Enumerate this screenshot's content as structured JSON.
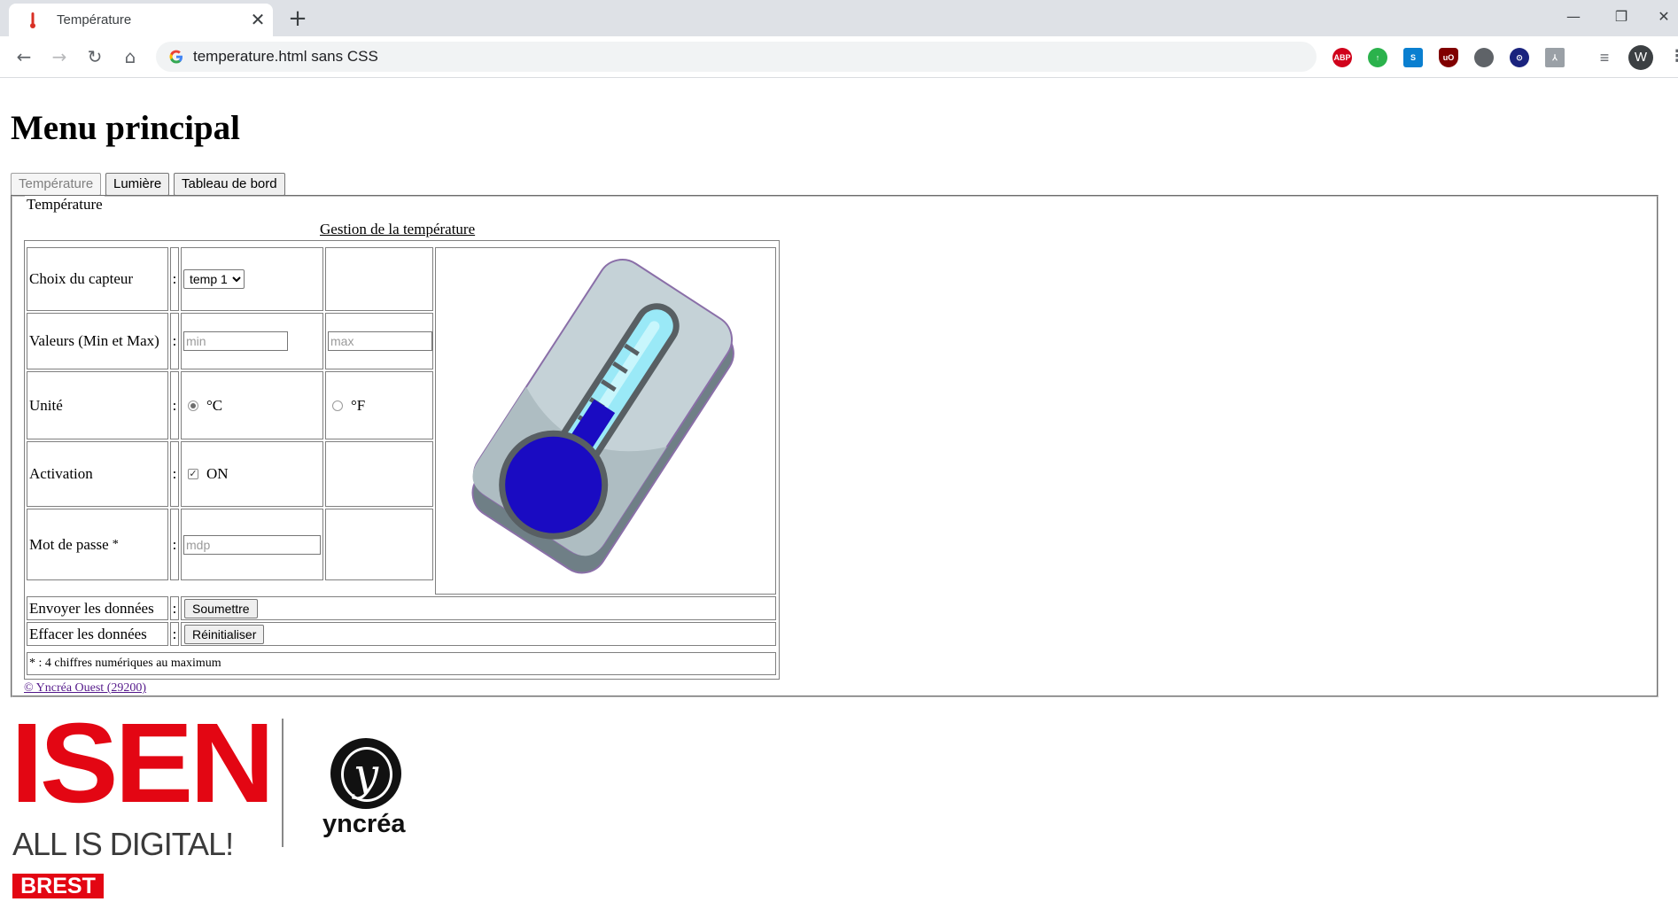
{
  "browser": {
    "tab_title": "Température",
    "address": "temperature.html sans CSS",
    "new_tab_symbol": "+",
    "tab_close_symbol": "✕",
    "avatar_initial": "W",
    "extensions": [
      "adblock-plus-icon",
      "green-extension-icon",
      "skype-extension-icon",
      "ublock-icon",
      "grey-circle-extension-icon",
      "lock-extension-icon",
      "pdf-extension-icon",
      "playlist-icon"
    ],
    "window_controls": {
      "minimize": "—",
      "restore": "❐",
      "close": "✕"
    }
  },
  "page": {
    "title": "Menu principal",
    "menu": [
      "Température",
      "Lumière",
      "Tableau de bord"
    ],
    "fieldset_legend": "Température",
    "caption": "Gestion de la température",
    "colon": ":",
    "rows": {
      "sensor_label": "Choix du capteur",
      "sensor_value": "temp 1",
      "values_label": "Valeurs (Min et Max)",
      "min_placeholder": "min",
      "max_placeholder": "max",
      "unit_label": "Unité",
      "unit_c": "°C",
      "unit_f": "°F",
      "activation_label": "Activation",
      "activation_value": "ON",
      "password_label": "Mot de passe",
      "password_star": "*",
      "password_placeholder": "mdp",
      "send_label": "Envoyer les données",
      "send_button": "Soumettre",
      "reset_label": "Effacer les données",
      "reset_button": "Réinitialiser"
    },
    "footnote": "* : 4 chiffres numériques au maximum",
    "copyright": "© Yncréa Ouest (29200)",
    "logos": {
      "isen": "ISEN",
      "isen_tagline": "ALL IS DIGITAL!",
      "isen_city": "BREST",
      "yncrea": "yncréa",
      "yncrea_mark": "y"
    },
    "colors": {
      "isen_red": "#e30613",
      "thermo_bulb": "#1a0bc2",
      "thermo_liquid": "#9ae9f7",
      "link": "#551a8b"
    }
  }
}
